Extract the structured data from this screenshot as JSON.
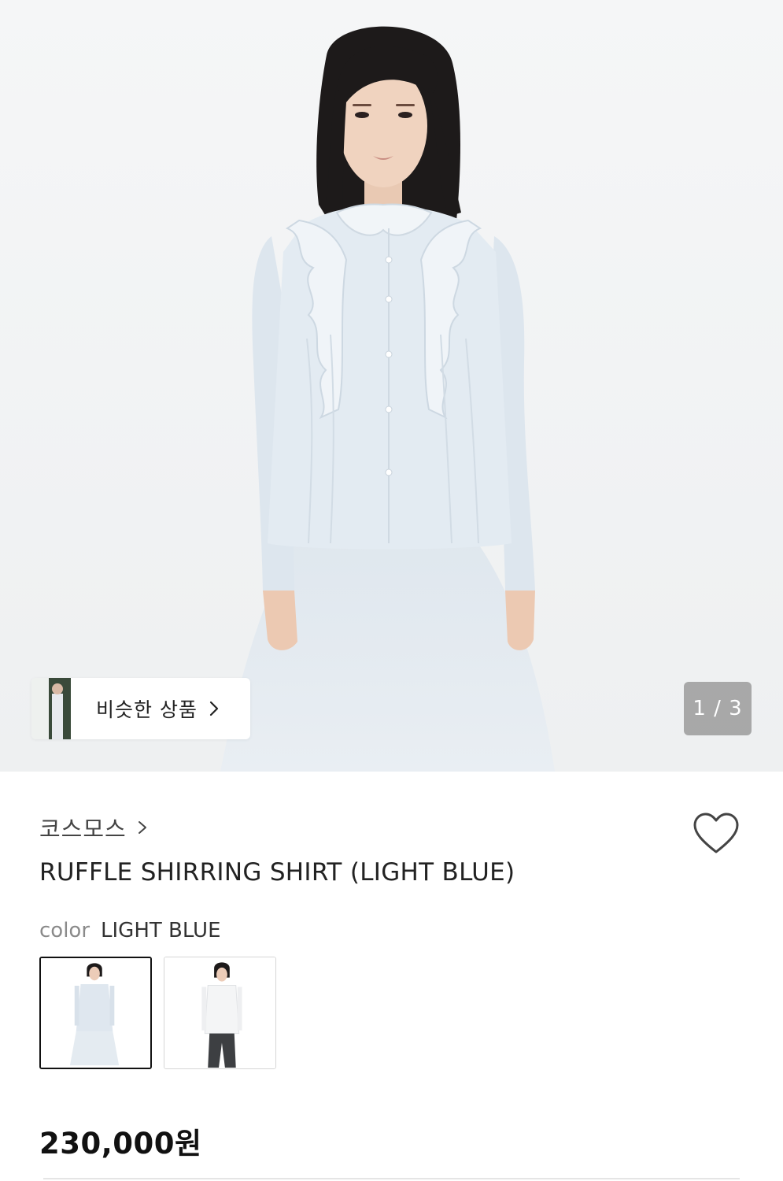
{
  "gallery": {
    "current_page": 1,
    "total_pages": 3,
    "counter_text": "1 / 3",
    "similar_button_label": "비슷한 상품"
  },
  "product": {
    "brand": "코스모스",
    "title": "RUFFLE SHIRRING SHIRT (LIGHT BLUE)",
    "color_label": "color",
    "color_value": "LIGHT BLUE",
    "price": "230,000원"
  },
  "color_options": [
    {
      "name": "LIGHT BLUE",
      "selected": true
    },
    {
      "name": "WHITE",
      "selected": false
    }
  ],
  "icons": {
    "wishlist": "heart-outline-icon",
    "brand_link": "chevron-right-icon",
    "similar_link": "chevron-right-icon"
  },
  "colors": {
    "shirt": "#e3ebf2",
    "background": "#f3f4f5",
    "accent": "#111111"
  }
}
